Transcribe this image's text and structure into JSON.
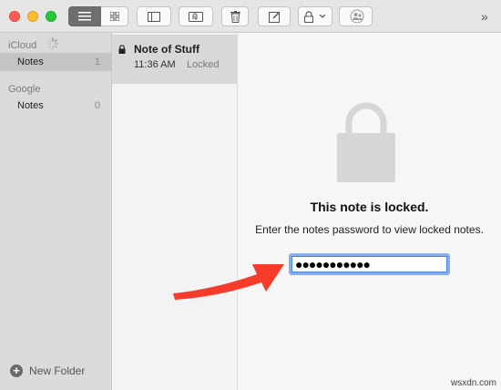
{
  "sidebar": {
    "accounts": [
      {
        "name": "iCloud",
        "folders": [
          {
            "name": "Notes",
            "count": "1"
          }
        ]
      },
      {
        "name": "Google",
        "folders": [
          {
            "name": "Notes",
            "count": "0"
          }
        ]
      }
    ],
    "new_folder_label": "New Folder"
  },
  "toolbar": {
    "buttons": [
      "list-view-icon",
      "gallery-view-icon",
      "sidebar-toggle-icon",
      "attachments-icon",
      "trash-icon",
      "compose-icon",
      "lock-icon",
      "chevron-down-icon",
      "share-people-icon",
      "chevron-right-double-icon"
    ],
    "overflow_label": "»"
  },
  "notes": [
    {
      "title": "Note of Stuff",
      "time": "11:36 AM",
      "status": "Locked"
    }
  ],
  "content": {
    "locked_title": "This note is locked.",
    "locked_message": "Enter the notes password to view locked notes.",
    "password_masked": "●●●●●●●●●●●"
  },
  "watermark": "wsxdn.com",
  "colors": {
    "accent_focus": "#4a86d8",
    "annotation_arrow": "#f53b2a",
    "selected_folder": "#c5c4c5",
    "selected_note": "#d8d8d8"
  }
}
